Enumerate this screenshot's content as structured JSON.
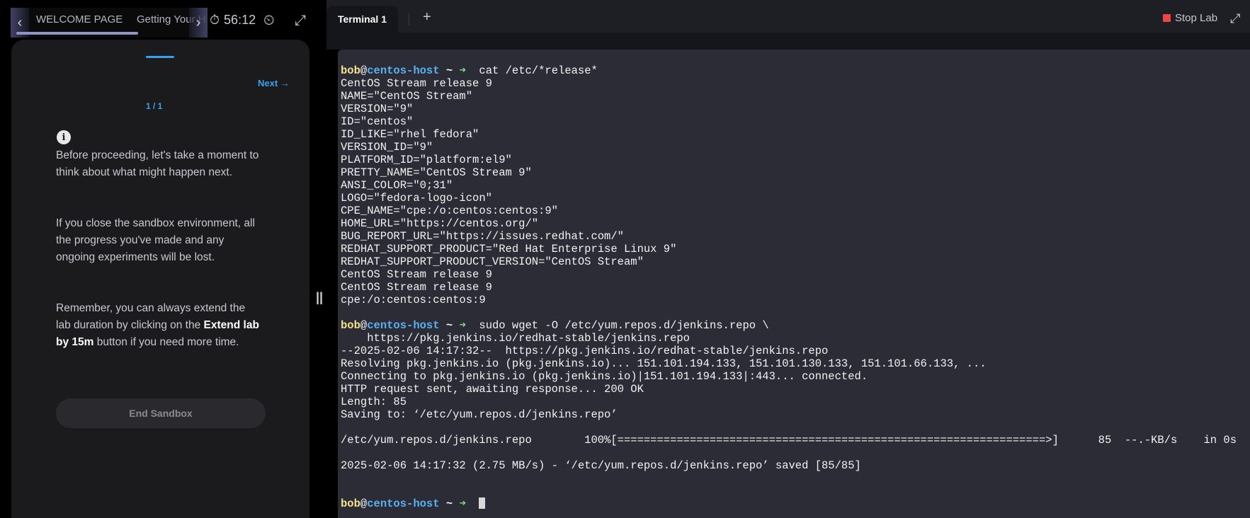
{
  "left": {
    "tabs": [
      "WELCOME PAGE",
      "Getting Your H"
    ],
    "progress_fraction": 0.62,
    "timer": "56:12",
    "icons": {
      "left_arrow": "chevron-left-icon",
      "right_arrow": "chevron-right-icon",
      "timer": "stopwatch-icon",
      "extend": "add-timer-icon",
      "expand": "expand-icon"
    },
    "next_label": "Next",
    "page_count": "1 / 1",
    "paragraph1": "Before proceeding, let's take a moment to think about what might happen next.",
    "paragraph2": "If you close the sandbox environment, all the progress you've made and any ongoing experiments will be lost.",
    "paragraph3_pre": "Remember, you can always extend the lab duration by clicking on the ",
    "paragraph3_bold": "Extend lab by 15m",
    "paragraph3_post": " button if you need more time.",
    "end_button": "End Sandbox"
  },
  "right": {
    "tab_label": "Terminal 1",
    "add_tab": "+",
    "stop_label": "Stop Lab",
    "prompt": {
      "user": "bob",
      "at": "@",
      "host": "centos-host",
      "dir": " ~ ",
      "arrow": "➜"
    },
    "cmd1": "  cat /etc/*release*",
    "out1": [
      "CentOS Stream release 9",
      "NAME=\"CentOS Stream\"",
      "VERSION=\"9\"",
      "ID=\"centos\"",
      "ID_LIKE=\"rhel fedora\"",
      "VERSION_ID=\"9\"",
      "PLATFORM_ID=\"platform:el9\"",
      "PRETTY_NAME=\"CentOS Stream 9\"",
      "ANSI_COLOR=\"0;31\"",
      "LOGO=\"fedora-logo-icon\"",
      "CPE_NAME=\"cpe:/o:centos:centos:9\"",
      "HOME_URL=\"https://centos.org/\"",
      "BUG_REPORT_URL=\"https://issues.redhat.com/\"",
      "REDHAT_SUPPORT_PRODUCT=\"Red Hat Enterprise Linux 9\"",
      "REDHAT_SUPPORT_PRODUCT_VERSION=\"CentOS Stream\"",
      "CentOS Stream release 9",
      "CentOS Stream release 9",
      "cpe:/o:centos:centos:9"
    ],
    "cmd2": "  sudo wget -O /etc/yum.repos.d/jenkins.repo \\",
    "out2": [
      "    https://pkg.jenkins.io/redhat-stable/jenkins.repo",
      "--2025-02-06 14:17:32--  https://pkg.jenkins.io/redhat-stable/jenkins.repo",
      "Resolving pkg.jenkins.io (pkg.jenkins.io)... 151.101.194.133, 151.101.130.133, 151.101.66.133, ...",
      "Connecting to pkg.jenkins.io (pkg.jenkins.io)|151.101.194.133|:443... connected.",
      "HTTP request sent, awaiting response... 200 OK",
      "Length: 85",
      "Saving to: ‘/etc/yum.repos.d/jenkins.repo’",
      "",
      "/etc/yum.repos.d/jenkins.repo        100%[=================================================================>]      85  --.-KB/s    in 0s",
      "",
      "2025-02-06 14:17:32 (2.75 MB/s) - ‘/etc/yum.repos.d/jenkins.repo’ saved [85/85]",
      "",
      ""
    ]
  }
}
